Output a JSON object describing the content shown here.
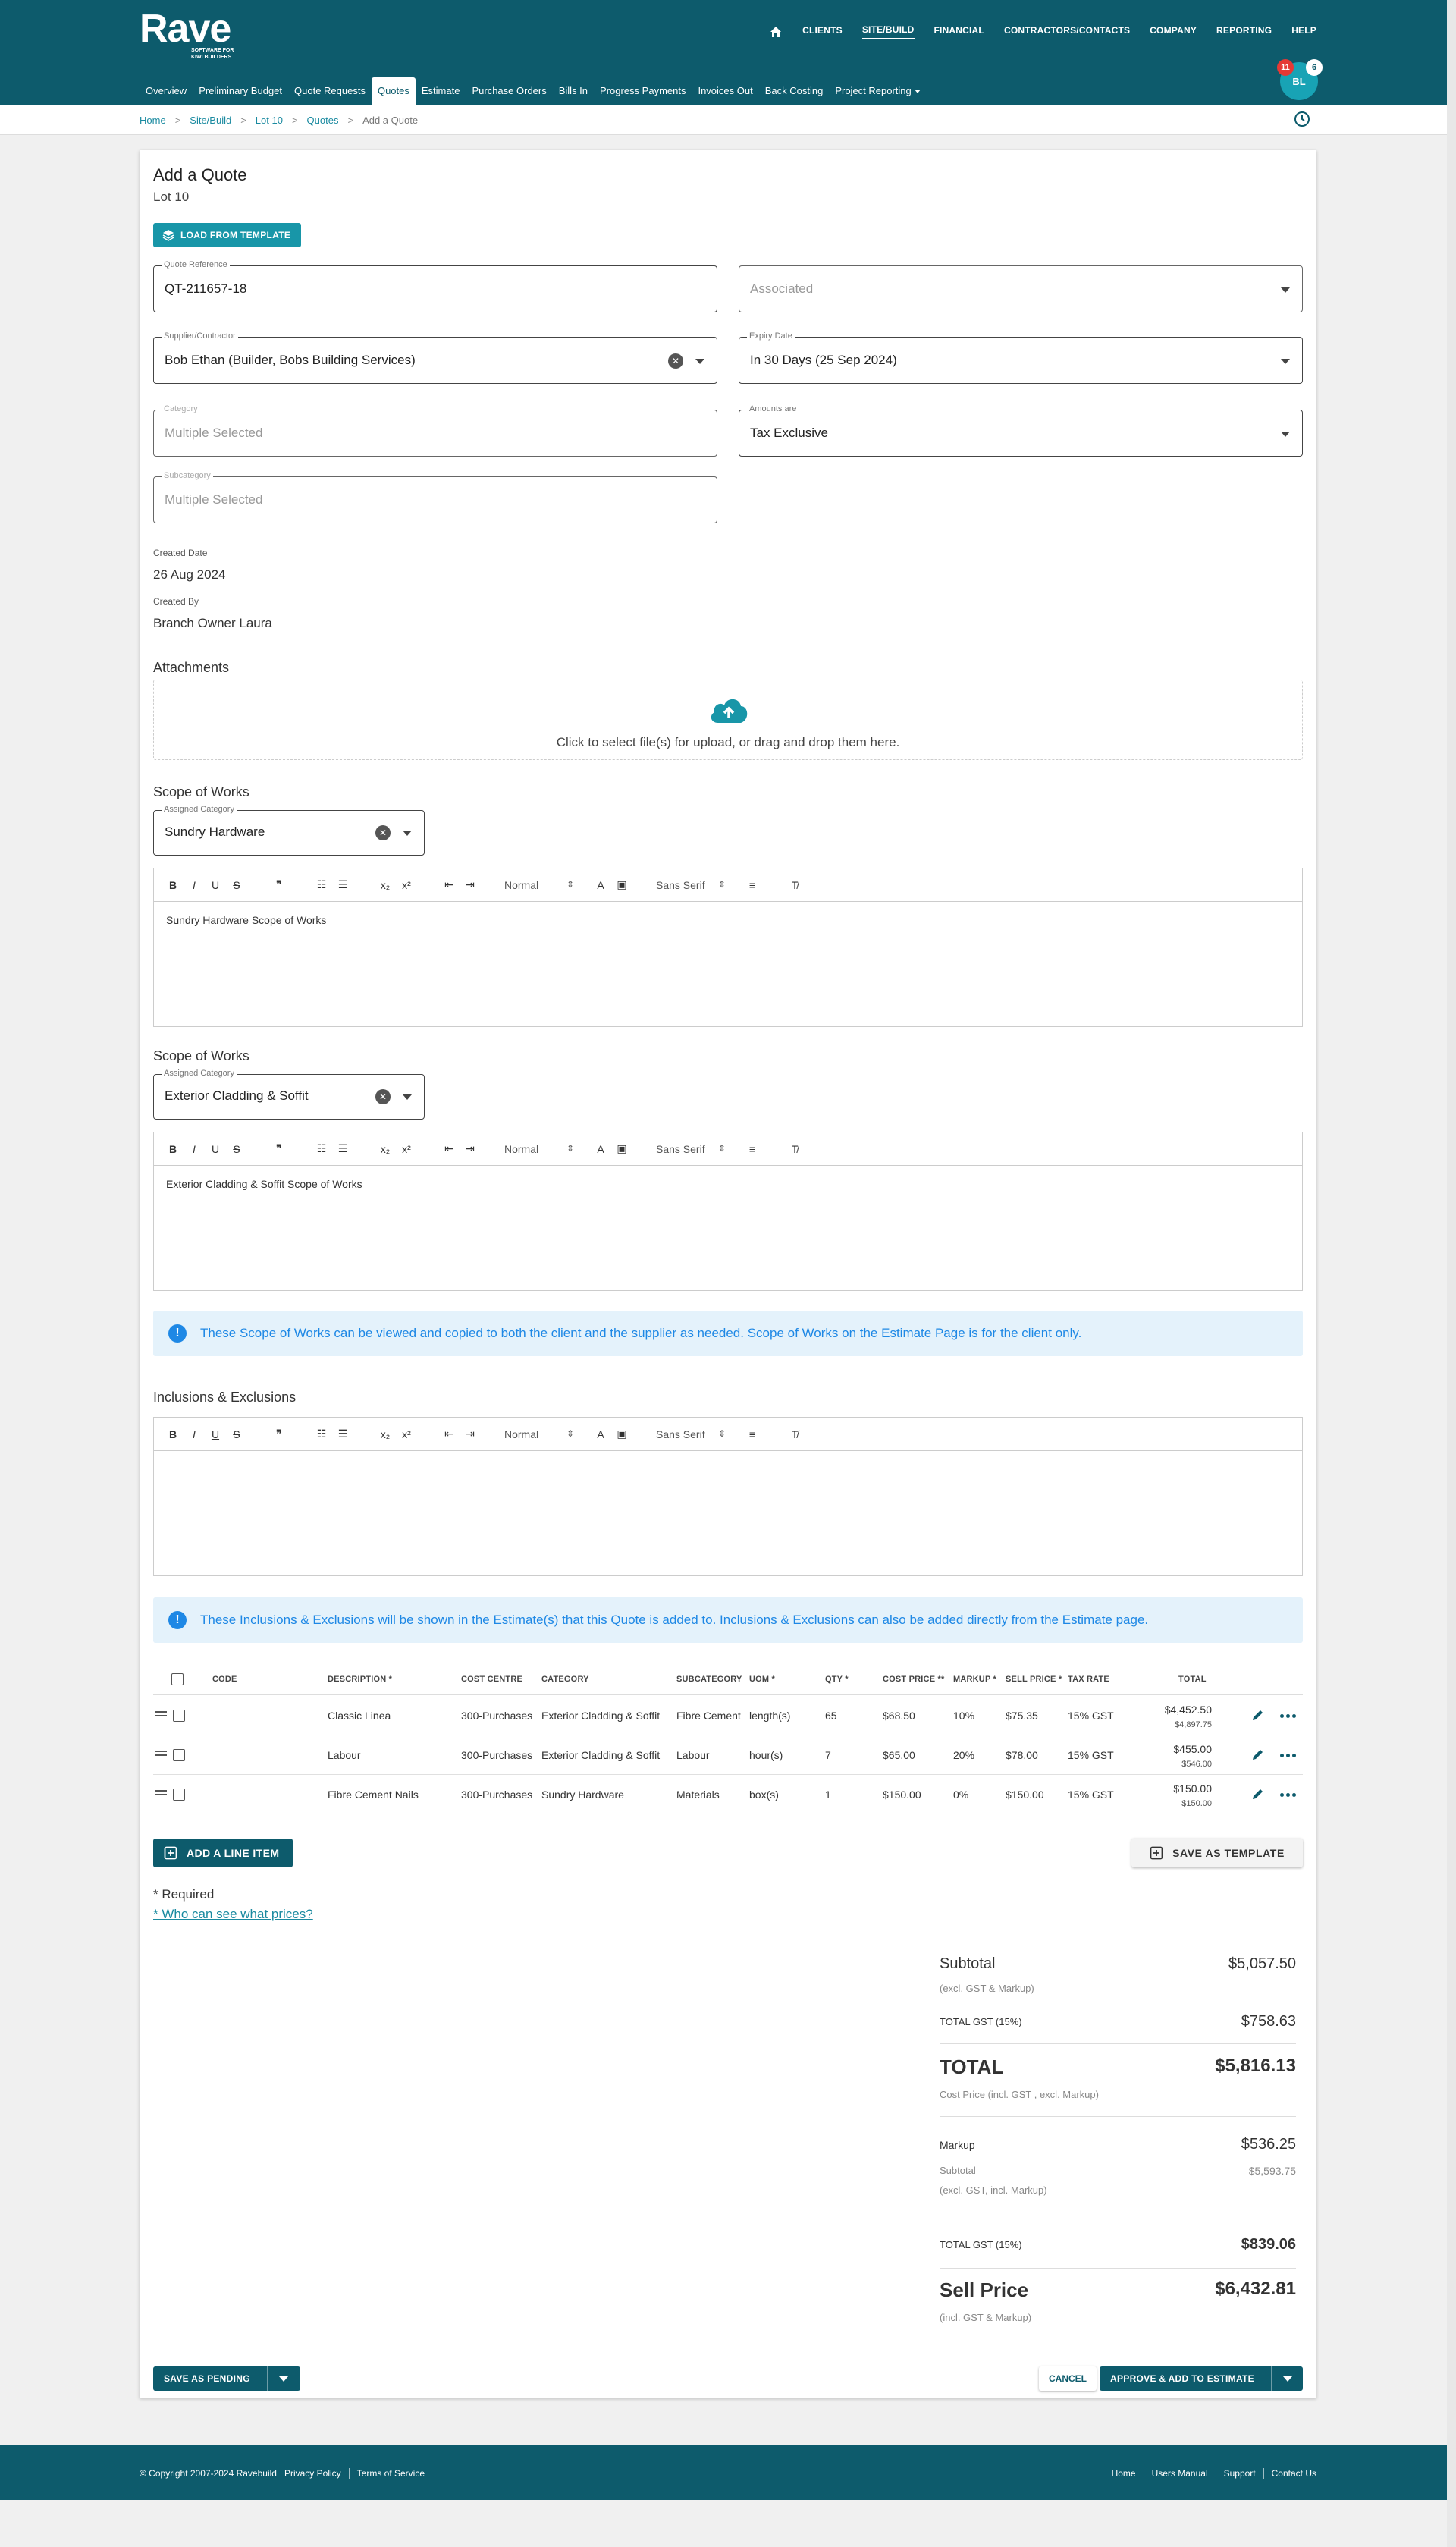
{
  "brand": {
    "name": "Rave",
    "tagline": "SOFTWARE FOR KIWI BUILDERS"
  },
  "topnav": [
    "CLIENTS",
    "SITE/BUILD",
    "FINANCIAL",
    "CONTRACTORS/CONTACTS",
    "COMPANY",
    "REPORTING",
    "HELP"
  ],
  "topnav_active": "SITE/BUILD",
  "subnav": [
    "Overview",
    "Preliminary Budget",
    "Quote Requests",
    "Quotes",
    "Estimate",
    "Purchase Orders",
    "Bills In",
    "Progress Payments",
    "Invoices Out",
    "Back Costing",
    "Project Reporting"
  ],
  "subnav_active": "Quotes",
  "user": {
    "initials": "BL",
    "notifications": "11",
    "messages": "6"
  },
  "breadcrumb": [
    "Home",
    "Site/Build",
    "Lot 10",
    "Quotes",
    "Add a Quote"
  ],
  "form": {
    "title": "Add a Quote",
    "subtitle": "Lot 10",
    "load_template": "LOAD FROM TEMPLATE",
    "quote_ref": {
      "label": "Quote Reference",
      "value": "QT-211657-18"
    },
    "associated": {
      "placeholder": "Associated"
    },
    "supplier": {
      "label": "Supplier/Contractor",
      "value": "Bob Ethan (Builder, Bobs Building Services)"
    },
    "expiry": {
      "label": "Expiry Date",
      "value": "In 30 Days (25 Sep 2024)"
    },
    "category": {
      "label": "Category",
      "placeholder": "Multiple Selected"
    },
    "amounts": {
      "label": "Amounts are",
      "value": "Tax Exclusive"
    },
    "subcategory": {
      "label": "Subcategory",
      "placeholder": "Multiple Selected"
    },
    "created_date_label": "Created Date",
    "created_date": "26 Aug 2024",
    "created_by_label": "Created By",
    "created_by": "Branch Owner Laura",
    "attachments_label": "Attachments",
    "upload_text": "Click to select file(s) for upload, or drag and drop them here."
  },
  "editor_toolbar": {
    "size": "Normal",
    "font": "Sans Serif"
  },
  "scope": [
    {
      "heading": "Scope of Works",
      "assigned_label": "Assigned Category",
      "category": "Sundry Hardware",
      "text": "Sundry Hardware Scope of Works"
    },
    {
      "heading": "Scope of Works",
      "assigned_label": "Assigned Category",
      "category": "Exterior Cladding & Soffit",
      "text": "Exterior Cladding & Soffit Scope of Works"
    }
  ],
  "info_scope": "These Scope of Works can be viewed and copied to both the client and the supplier as needed. Scope of Works on the Estimate Page is for the client only.",
  "inclusions_heading": "Inclusions & Exclusions",
  "info_incl": "These Inclusions & Exclusions will be shown in the Estimate(s) that this Quote is added to. Inclusions & Exclusions can also be added directly from the Estimate page.",
  "table": {
    "headers": {
      "code": "CODE",
      "description": "DESCRIPTION *",
      "cost_centre": "COST CENTRE",
      "category": "CATEGORY",
      "subcategory": "SUBCATEGORY",
      "uom": "UOM *",
      "qty": "QTY *",
      "cost_price": "COST PRICE **",
      "markup": "MARKUP *",
      "sell_price": "SELL PRICE *",
      "tax_rate": "TAX RATE",
      "total": "TOTAL"
    },
    "rows": [
      {
        "description": "Classic Linea",
        "cost_centre": "300-Purchases",
        "category": "Exterior Cladding & Soffit",
        "subcategory": "Fibre Cement",
        "uom": "length(s)",
        "qty": "65",
        "cost_price": "$68.50",
        "markup": "10%",
        "sell_price": "$75.35",
        "tax_rate": "15% GST",
        "total": "$4,452.50",
        "total_sell": "$4,897.75"
      },
      {
        "description": "Labour",
        "cost_centre": "300-Purchases",
        "category": "Exterior Cladding & Soffit",
        "subcategory": "Labour",
        "uom": "hour(s)",
        "qty": "7",
        "cost_price": "$65.00",
        "markup": "20%",
        "sell_price": "$78.00",
        "tax_rate": "15% GST",
        "total": "$455.00",
        "total_sell": "$546.00"
      },
      {
        "description": "Fibre Cement Nails",
        "cost_centre": "300-Purchases",
        "category": "Sundry Hardware",
        "subcategory": "Materials",
        "uom": "box(s)",
        "qty": "1",
        "cost_price": "$150.00",
        "markup": "0%",
        "sell_price": "$150.00",
        "tax_rate": "15% GST",
        "total": "$150.00",
        "total_sell": "$150.00"
      }
    ]
  },
  "actions": {
    "add_line": "ADD A LINE ITEM",
    "save_template": "SAVE AS TEMPLATE",
    "required": "* Required",
    "who_link": "* Who can see what prices?",
    "save_pending": "SAVE AS PENDING",
    "cancel": "CANCEL",
    "approve": "APPROVE & ADD TO ESTIMATE"
  },
  "summary": {
    "subtotal_label": "Subtotal",
    "subtotal": "$5,057.50",
    "subtotal_note": "(excl. GST & Markup)",
    "gst_label": "TOTAL GST (15%)",
    "gst": "$758.63",
    "total_label": "TOTAL",
    "total": "$5,816.13",
    "total_note": "Cost Price (incl. GST , excl. Markup)",
    "markup_label": "Markup",
    "markup": "$536.25",
    "sub2_label": "Subtotal",
    "sub2": "$5,593.75",
    "sub2_note": "(excl. GST, incl. Markup)",
    "gst2_label": "TOTAL GST (15%)",
    "gst2": "$839.06",
    "sell_label": "Sell Price",
    "sell": "$6,432.81",
    "sell_note": "(incl. GST & Markup)"
  },
  "footer": {
    "copyright": "© Copyright 2007-2024 Ravebuild",
    "left_links": [
      "Privacy Policy",
      "Terms of Service"
    ],
    "right_links": [
      "Home",
      "Users Manual",
      "Support",
      "Contact Us"
    ]
  },
  "colors": {
    "primary": "#0d5b6c",
    "accent": "#1896a8",
    "info": "#1e88e5"
  }
}
